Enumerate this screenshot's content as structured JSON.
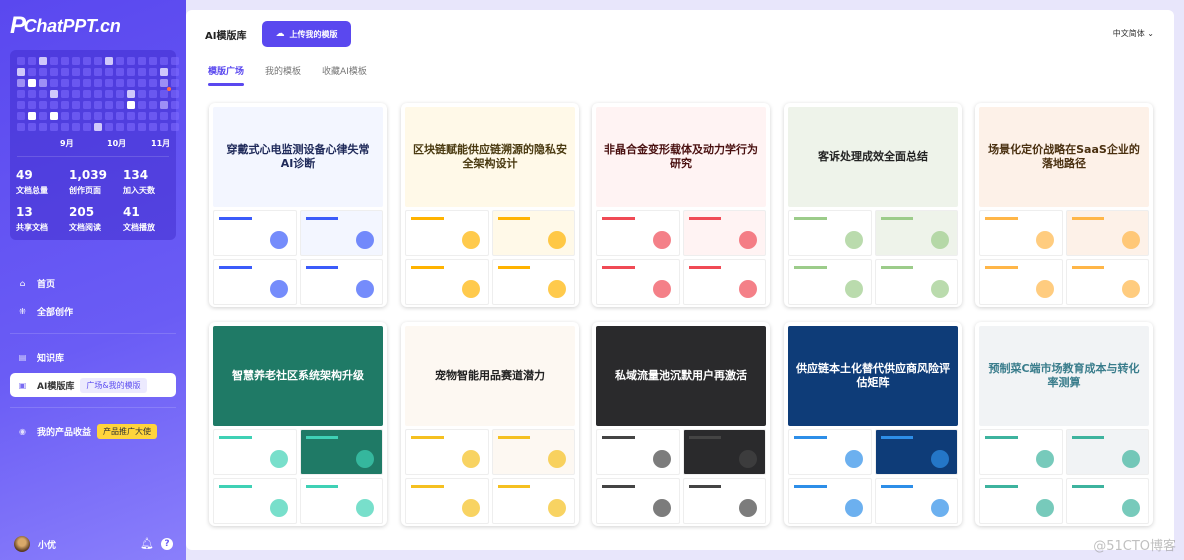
{
  "app": {
    "logo": "ChatPPT.cn"
  },
  "activity": {
    "levels": [
      [
        0,
        0,
        2,
        0,
        0,
        0,
        0,
        0,
        2,
        0,
        0,
        0,
        0,
        0,
        0
      ],
      [
        2,
        0,
        0,
        0,
        0,
        0,
        0,
        0,
        0,
        0,
        0,
        0,
        0,
        2,
        0
      ],
      [
        1,
        3,
        1,
        0,
        0,
        0,
        0,
        0,
        0,
        0,
        0,
        0,
        0,
        1,
        0
      ],
      [
        0,
        0,
        0,
        2,
        0,
        0,
        0,
        0,
        0,
        0,
        2,
        0,
        0,
        0,
        0
      ],
      [
        0,
        0,
        0,
        0,
        0,
        0,
        0,
        0,
        0,
        0,
        3,
        0,
        0,
        1,
        0
      ],
      [
        0,
        3,
        0,
        3,
        0,
        0,
        0,
        0,
        0,
        0,
        0,
        0,
        0,
        0,
        0
      ],
      [
        0,
        0,
        0,
        0,
        0,
        0,
        0,
        2,
        0,
        0,
        0,
        0,
        0,
        0,
        0
      ]
    ],
    "months": [
      "9月",
      "10月",
      "11月"
    ]
  },
  "stats": [
    {
      "value": "49",
      "label": "文档总量"
    },
    {
      "value": "1,039",
      "label": "创作页面"
    },
    {
      "value": "134",
      "label": "加入天数"
    },
    {
      "value": "13",
      "label": "共享文档"
    },
    {
      "value": "205",
      "label": "文档阅读"
    },
    {
      "value": "41",
      "label": "文档播放"
    }
  ],
  "nav": {
    "home": "首页",
    "all": "全部创作",
    "kb": "知识库",
    "templates": "AI模版库",
    "templates_tag": "广场&我的模版",
    "earnings": "我的产品收益",
    "earnings_tag": "产品推广大使"
  },
  "user": {
    "name": "小优"
  },
  "header": {
    "title": "AI模版库",
    "upload": "上传我的模版",
    "language": "中文简体"
  },
  "tabs": [
    "模版广场",
    "我的模板",
    "收藏AI模板"
  ],
  "templates": [
    {
      "title": "穿戴式心电监测设备心律失常AI诊断",
      "bg": "#f3f6ff",
      "color": "#1f2a5a",
      "accent": "#3b5bfa"
    },
    {
      "title": "区块链赋能供应链溯源的隐私安全架构设计",
      "bg": "#fff9e8",
      "color": "#4a3a10",
      "accent": "#ffb300"
    },
    {
      "title": "非晶合金变形载体及动力学行为研究",
      "bg": "#fff3f3",
      "color": "#4a1010",
      "accent": "#f04a55"
    },
    {
      "title": "客诉处理成效全面总结",
      "bg": "#eef3ea",
      "color": "#222",
      "accent": "#9ccc8a"
    },
    {
      "title": "场景化定价战略在SaaS企业的落地路径",
      "bg": "#fdf1e8",
      "color": "#4a3010",
      "accent": "#ffb648"
    },
    {
      "title": "智慧养老社区系统架构升级",
      "bg": "#1f7a66",
      "color": "#fff",
      "accent": "#3fd1b5"
    },
    {
      "title": "宠物智能用品赛道潜力",
      "bg": "#fdf8f2",
      "color": "#222",
      "accent": "#f5c020"
    },
    {
      "title": "私域流量池沉默用户再激活",
      "bg": "#2a2a2c",
      "color": "#fff",
      "accent": "#444"
    },
    {
      "title": "供应链本土化替代供应商风险评估矩阵",
      "bg": "#0e3c78",
      "color": "#fff",
      "accent": "#2d8ee8"
    },
    {
      "title": "预制菜C端市场教育成本与转化率测算",
      "bg": "#f1f3f5",
      "color": "#3a7d8c",
      "accent": "#3db39e"
    }
  ],
  "watermark": "@51CTO博客"
}
